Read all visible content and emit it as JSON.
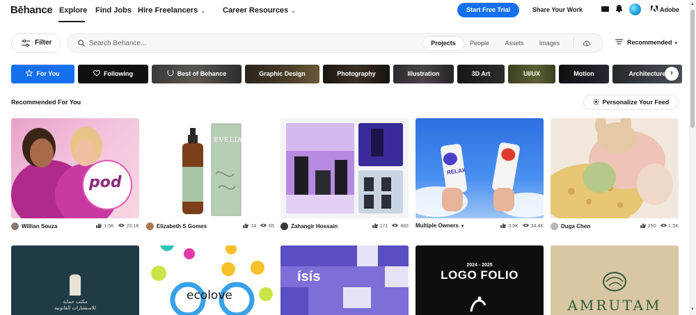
{
  "brand": {
    "logo": "Bēhance"
  },
  "nav": {
    "explore": "Explore",
    "find_jobs": "Find Jobs",
    "hire_freelancers": "Hire Freelancers",
    "career_resources": "Career Resources",
    "start_trial": "Start Free Trial",
    "share_work": "Share Your Work",
    "adobe": "Adobe"
  },
  "search": {
    "filter_label": "Filter",
    "placeholder": "Search Behance...",
    "segments": [
      "Projects",
      "People",
      "Assets",
      "Images"
    ],
    "active_segment": "Projects",
    "sort_label": "Recommended"
  },
  "categories": [
    {
      "label": "For You",
      "icon": "star-icon"
    },
    {
      "label": "Following",
      "icon": "heart-icon"
    },
    {
      "label": "Best of Behance",
      "icon": "laurel-icon"
    },
    {
      "label": "Graphic Design"
    },
    {
      "label": "Photography"
    },
    {
      "label": "Illustration"
    },
    {
      "label": "3D Art"
    },
    {
      "label": "UI/UX"
    },
    {
      "label": "Motion"
    },
    {
      "label": "Architecture"
    }
  ],
  "section": {
    "title": "Recommended For You",
    "personalize": "Personalize Your Feed"
  },
  "projects": [
    {
      "owner": "Willian Souza",
      "likes": "1.5K",
      "views": "23.1K",
      "thumb_text": "pod"
    },
    {
      "owner": "Elizabeth S Gomes",
      "likes": "14",
      "views": "65",
      "thumb_text": "EVELIA"
    },
    {
      "owner": "Zahangir Hossain",
      "likes": "171",
      "views": "883"
    },
    {
      "owner": "Multiple Owners",
      "likes": "3.9K",
      "views": "34.4K",
      "thumb_text": "RELAX"
    },
    {
      "owner": "Duga Chen",
      "likes": "250",
      "views": "1.5K"
    }
  ],
  "second_row": [
    {
      "thumb_text": "مكتب حماية\nللاستشارات القانونية"
    },
    {
      "thumb_text": "ecolove"
    },
    {
      "thumb_text": "ísís"
    },
    {
      "thumb_text_small": "2024 - 2025",
      "thumb_text": "LOGO FOLIO"
    },
    {
      "thumb_text": "AMRUTAM"
    }
  ]
}
